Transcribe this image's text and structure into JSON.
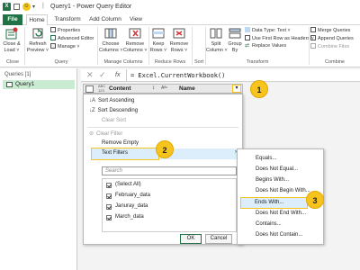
{
  "window": {
    "app_icon": "excel-icon",
    "title": "Query1 - Power Query Editor",
    "separator": "|"
  },
  "tabs": [
    {
      "label": "File"
    },
    {
      "label": "Home"
    },
    {
      "label": "Transform"
    },
    {
      "label": "Add Column"
    },
    {
      "label": "View"
    }
  ],
  "ribbon": {
    "close_load": "Close &\nLoad ˅",
    "refresh_preview": "Refresh\nPreview ˅",
    "properties": "Properties",
    "advanced_editor": "Advanced Editor",
    "manage": "Manage ˅",
    "choose_columns": "Choose\nColumns ˅",
    "remove_columns": "Remove\nColumns ˅",
    "keep_rows": "Keep\nRows ˅",
    "remove_rows": "Remove\nRows ˅",
    "split_column": "Split\nColumn ˅",
    "group_by": "Group\nBy",
    "data_type": "Data Type: Text ˅",
    "first_row_headers": "Use First Row as Headers ˅",
    "replace_values": "Replace Values",
    "merge_queries": "Merge Queries",
    "append_queries": "Append Queries",
    "combine_files": "Combine Files",
    "groups": {
      "close": "Close",
      "query": "Query",
      "manage_columns": "Manage Columns",
      "reduce_rows": "Reduce Rows",
      "sort": "Sort",
      "transform": "Transform",
      "combine": "Combine"
    }
  },
  "queries": {
    "header": "Queries [1]",
    "items": [
      {
        "label": "Query1"
      }
    ]
  },
  "formula_bar": {
    "fx": "fx",
    "formula": "= Excel.CurrentWorkbook()"
  },
  "columns": [
    {
      "type_icon": "ABC\n123",
      "label": "Content"
    },
    {
      "type_icon": "Aᴮᶜ",
      "label": "Name"
    }
  ],
  "filter_menu": {
    "items": [
      {
        "label": "Sort Ascending",
        "enabled": true
      },
      {
        "label": "Sort Descending",
        "enabled": true
      },
      {
        "label": "Clear Sort",
        "enabled": false
      },
      {
        "label": "Clear Filter",
        "enabled": false
      },
      {
        "label": "Remove Empty",
        "enabled": true
      },
      {
        "label": "Text Filters",
        "enabled": true
      }
    ],
    "search_placeholder": "Search",
    "values": [
      {
        "label": "(Select All)",
        "checked": true
      },
      {
        "label": "February_data",
        "checked": true
      },
      {
        "label": "Januray_data",
        "checked": true
      },
      {
        "label": "March_data",
        "checked": true
      }
    ],
    "ok": "OK",
    "cancel": "Cancel"
  },
  "submenu": {
    "items": [
      {
        "label": "Equals..."
      },
      {
        "label": "Does Not Equal..."
      },
      {
        "label": "Begins With..."
      },
      {
        "label": "Does Not Begin With..."
      },
      {
        "label": "Ends With..."
      },
      {
        "label": "Does Not End With..."
      },
      {
        "label": "Contains..."
      },
      {
        "label": "Does Not Contain..."
      }
    ]
  },
  "callouts": [
    "1",
    "2",
    "3"
  ],
  "colors": {
    "excel_green": "#217346",
    "highlight_yellow": "#f7c41d",
    "file_tab": "#217346",
    "menu_hover": "#dceefb"
  }
}
